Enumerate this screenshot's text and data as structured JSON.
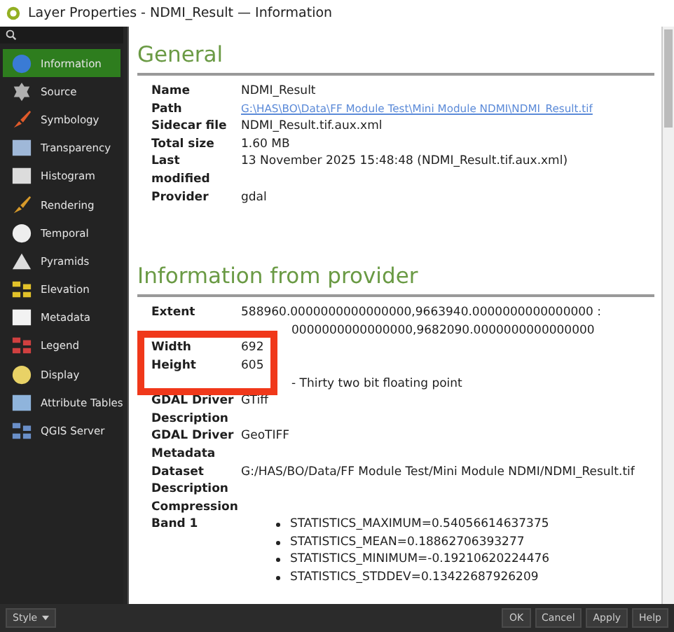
{
  "window": {
    "title": "Layer Properties - NDMI_Result — Information"
  },
  "sidebar": {
    "items": [
      {
        "label": "Information",
        "selected": true
      },
      {
        "label": "Source",
        "selected": false
      },
      {
        "label": "Symbology",
        "selected": false
      },
      {
        "label": "Transparency",
        "selected": false
      },
      {
        "label": "Histogram",
        "selected": false
      },
      {
        "label": "Rendering",
        "selected": false
      },
      {
        "label": "Temporal",
        "selected": false
      },
      {
        "label": "Pyramids",
        "selected": false
      },
      {
        "label": "Elevation",
        "selected": false
      },
      {
        "label": "Metadata",
        "selected": false
      },
      {
        "label": "Legend",
        "selected": false
      },
      {
        "label": "Display",
        "selected": false
      },
      {
        "label": "Attribute Tables",
        "selected": false
      },
      {
        "label": "QGIS Server",
        "selected": false
      }
    ]
  },
  "sections": [
    {
      "title": "General",
      "rows": [
        {
          "label": "Name",
          "value": "NDMI_Result"
        },
        {
          "label": "Path",
          "value": "G:\\HAS\\BO\\Data\\FF Module Test\\Mini Module NDMI\\NDMI_Result.tif",
          "kind": "link"
        },
        {
          "label": "Sidecar file",
          "value": "NDMI_Result.tif.aux.xml"
        },
        {
          "label": "Total size",
          "value": "1.60 MB"
        },
        {
          "label": "Last modified",
          "value": "13 November 2025 15:48:48 (NDMI_Result.tif.aux.xml)"
        },
        {
          "label": "Provider",
          "value": "gdal"
        }
      ]
    },
    {
      "title": "Information from provider",
      "rows": [
        {
          "label": "Extent",
          "value": "588960.0000000000000000,9663940.0000000000000000 :"
        },
        {
          "value": "0000000000000000,9682090.0000000000000000",
          "covered": true
        },
        {
          "label": "Width",
          "value": "692"
        },
        {
          "label": "Height",
          "value": "605"
        },
        {
          "value": "- Thirty two bit floating point",
          "covered": true
        },
        {
          "label": "GDAL Driver Description",
          "value": "GTiff"
        },
        {
          "label": "GDAL Driver Metadata",
          "value": "GeoTIFF"
        },
        {
          "label": "Dataset Description",
          "value": "G:/HAS/BO/Data/FF Module Test/Mini Module NDMI/NDMI_Result.tif"
        },
        {
          "label": "Compression"
        },
        {
          "label": "Band 1",
          "kind": "list",
          "items": [
            "STATISTICS_MAXIMUM=0.54056614637375",
            "STATISTICS_MEAN=0.18862706393277",
            "STATISTICS_MINIMUM=-0.19210620224476",
            "STATISTICS_STDDEV=0.13422687926209"
          ]
        }
      ]
    }
  ],
  "footer": {
    "style_button": "Style",
    "buttons": [
      "OK",
      "Cancel",
      "Apply",
      "Help"
    ]
  }
}
